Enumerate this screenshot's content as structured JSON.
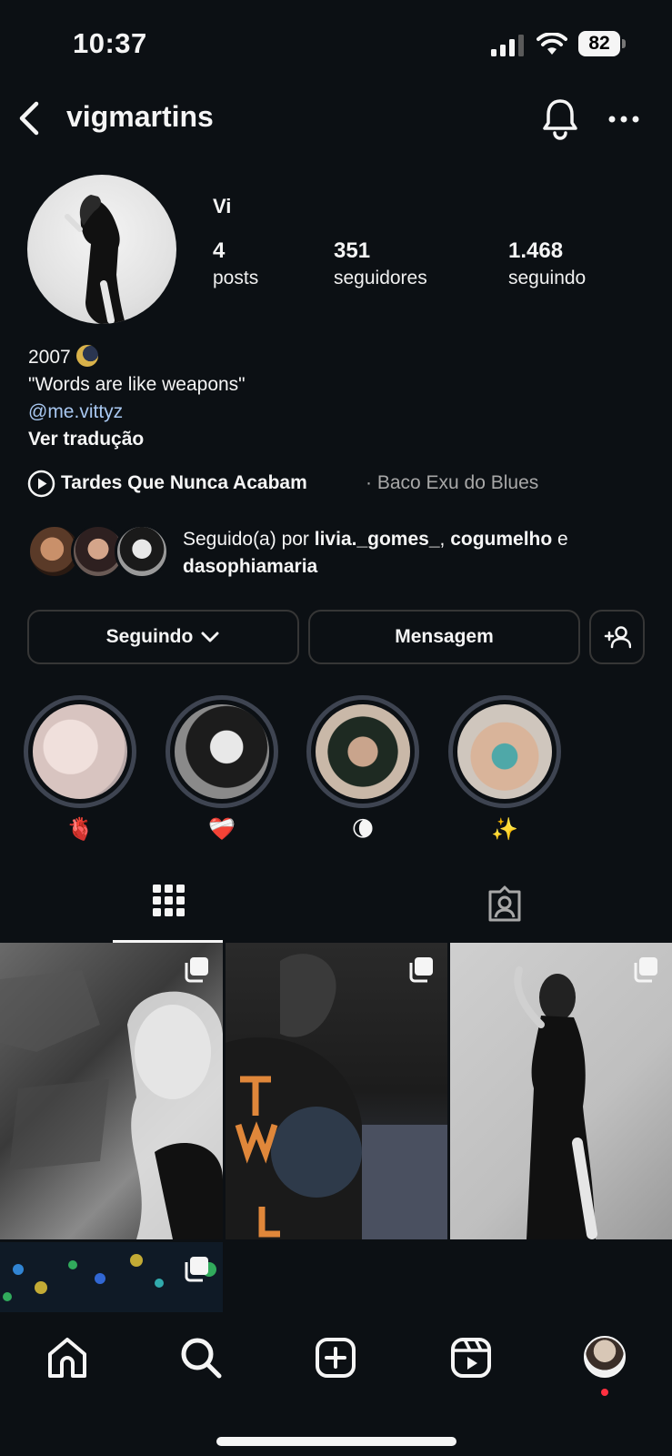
{
  "status_bar": {
    "time": "10:37",
    "battery": "82"
  },
  "header": {
    "username": "vigmartins"
  },
  "profile": {
    "display_name": "Vi",
    "stats": [
      {
        "value": "4",
        "label": "posts"
      },
      {
        "value": "351",
        "label": "seguidores"
      },
      {
        "value": "1.468",
        "label": "seguindo"
      }
    ],
    "bio": {
      "line1": "2007",
      "line2": "\"Words are like weapons\"",
      "link": "@me.vittyz",
      "translate": "Ver tradução"
    },
    "music": {
      "title": "Tardes Que Nunca Acabam",
      "separator": " · ",
      "artist": "Baco Exu do Blues"
    },
    "followed_by": {
      "prefix": "Seguido(a) por ",
      "user1": "livia._gomes_",
      "comma": ", ",
      "user2": "cogumelho",
      "conj": " e",
      "user3": "dasophiamaria"
    }
  },
  "actions": {
    "following": "Seguindo",
    "message": "Mensagem"
  },
  "highlights": [
    {
      "label": "🫀"
    },
    {
      "label": "❤️‍🩹"
    },
    {
      "label": "🌘"
    },
    {
      "label": "✨"
    }
  ],
  "colors": {
    "background": "#0c1014",
    "link": "#a8c7f0",
    "highlight_ring": "#3e4451",
    "notification": "#ff3040"
  }
}
